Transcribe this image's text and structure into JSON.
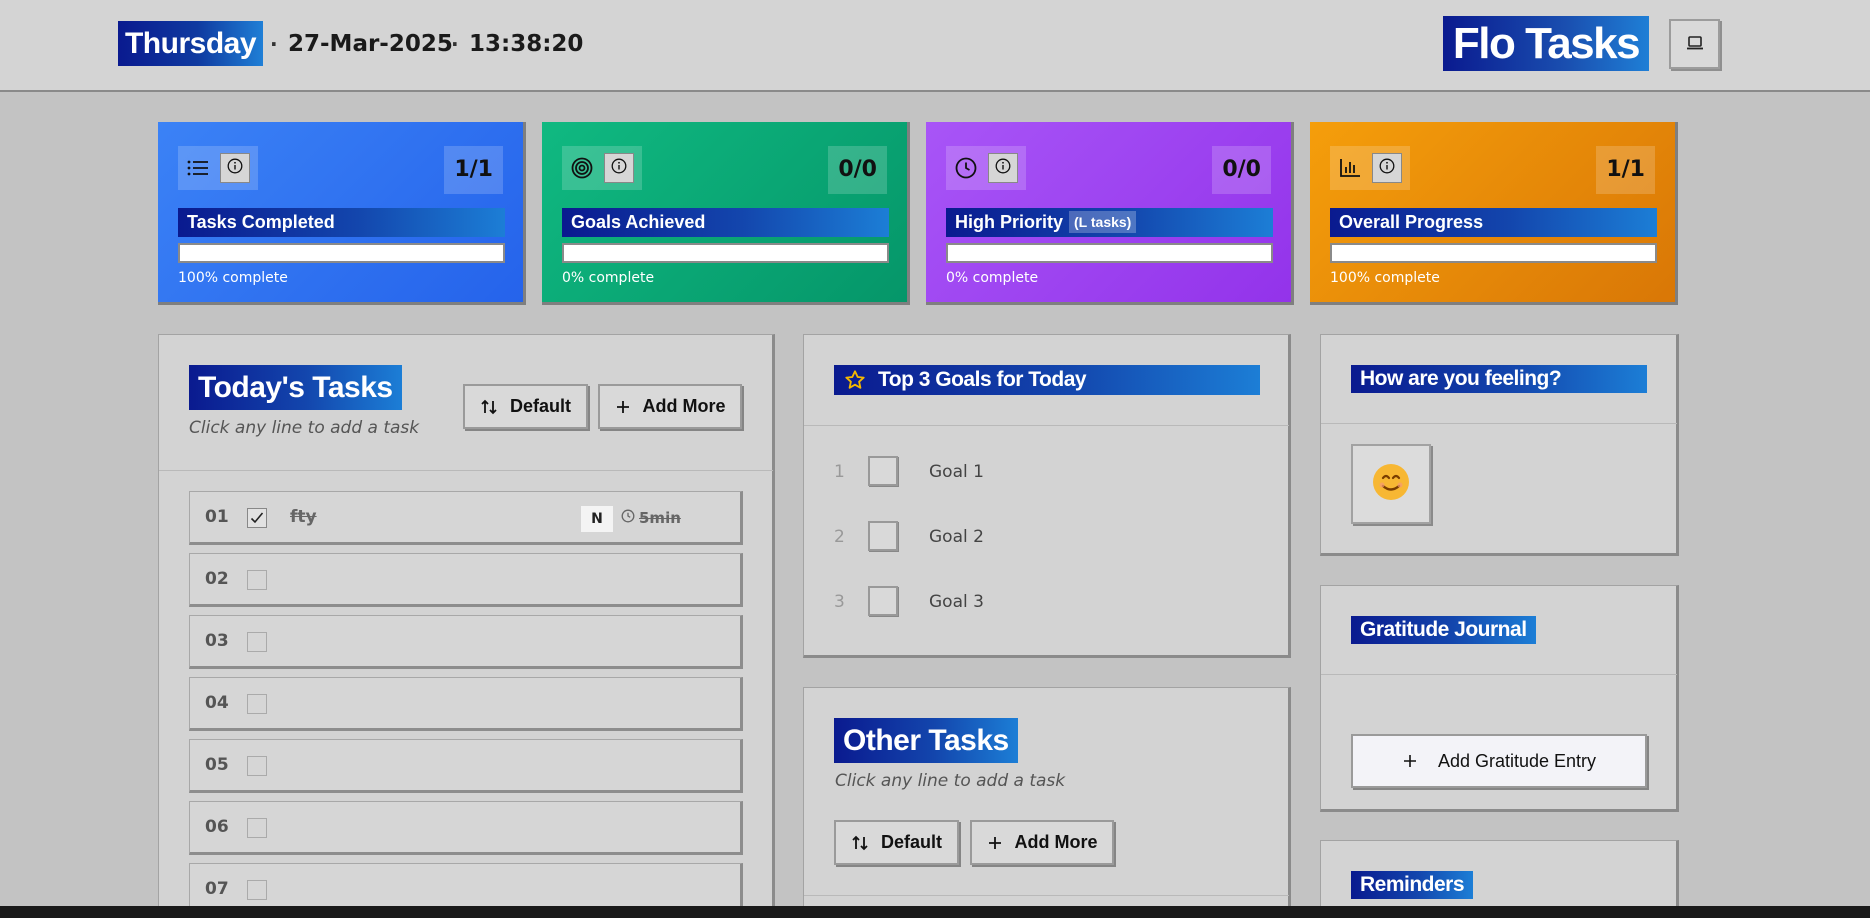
{
  "header": {
    "day": "Thursday",
    "date": "27-Mar-2025",
    "time": "13:38:20",
    "separator": "·",
    "brand": "Flo Tasks",
    "theme_button_icon": "laptop-icon"
  },
  "stats": [
    {
      "icon": "list-icon",
      "label": "Tasks Completed",
      "sublabel": "",
      "count": "1/1",
      "progress": 1.0,
      "percent_text": "100% complete",
      "color_start": "#3b82f6",
      "color_end": "#2563eb"
    },
    {
      "icon": "target-icon",
      "label": "Goals Achieved",
      "sublabel": "",
      "count": "0/0",
      "progress": 0.0,
      "percent_text": "0% complete",
      "color_start": "#10b981",
      "color_end": "#059669"
    },
    {
      "icon": "clock-icon",
      "label": "High Priority",
      "sublabel": "(L tasks)",
      "count": "0/0",
      "progress": 0.0,
      "percent_text": "0% complete",
      "color_start": "#a855f7",
      "color_end": "#9333ea"
    },
    {
      "icon": "bar-chart-icon",
      "label": "Overall Progress",
      "sublabel": "",
      "count": "1/1",
      "progress": 1.0,
      "percent_text": "100% complete",
      "color_start": "#f59e0b",
      "color_end": "#d97706"
    }
  ],
  "todays_tasks": {
    "title": "Today's Tasks",
    "hint": "Click any line to add a task",
    "sort_label": "Default",
    "add_label": "Add More",
    "rows": [
      {
        "num": "01",
        "checked": true,
        "text": "fty",
        "priority": "N",
        "duration": "5min"
      },
      {
        "num": "02",
        "checked": false,
        "text": "",
        "priority": "",
        "duration": ""
      },
      {
        "num": "03",
        "checked": false,
        "text": "",
        "priority": "",
        "duration": ""
      },
      {
        "num": "04",
        "checked": false,
        "text": "",
        "priority": "",
        "duration": ""
      },
      {
        "num": "05",
        "checked": false,
        "text": "",
        "priority": "",
        "duration": ""
      },
      {
        "num": "06",
        "checked": false,
        "text": "",
        "priority": "",
        "duration": ""
      },
      {
        "num": "07",
        "checked": false,
        "text": "",
        "priority": "",
        "duration": ""
      }
    ]
  },
  "goals": {
    "title": "Top 3 Goals for Today",
    "items": [
      {
        "num": "1",
        "text": "Goal 1"
      },
      {
        "num": "2",
        "text": "Goal 2"
      },
      {
        "num": "3",
        "text": "Goal 3"
      }
    ]
  },
  "other_tasks": {
    "title": "Other Tasks",
    "hint": "Click any line to add a task",
    "sort_label": "Default",
    "add_label": "Add More"
  },
  "mood": {
    "title": "How are you feeling?",
    "emoji": "😊"
  },
  "gratitude": {
    "title": "Gratitude Journal",
    "add_label": "Add Gratitude Entry"
  },
  "reminders": {
    "title": "Reminders"
  }
}
